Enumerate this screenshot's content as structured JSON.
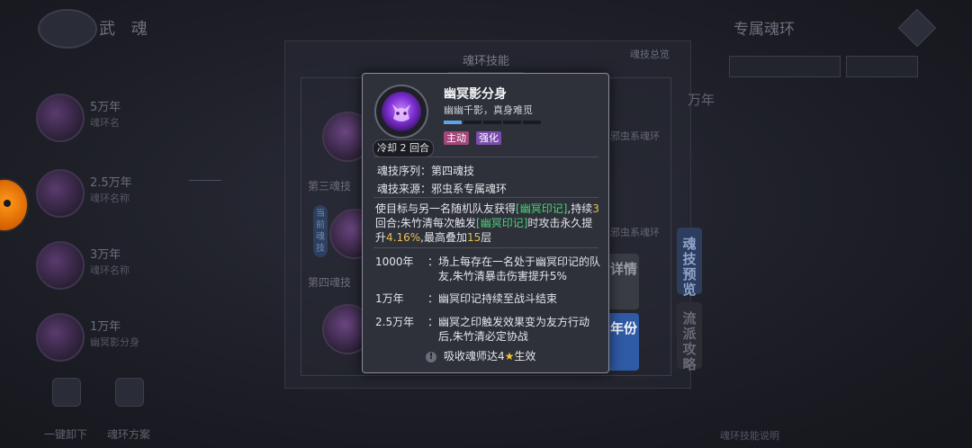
{
  "background": {
    "top_title": "武 魂",
    "top_right_title": "专属魂环",
    "dropdowns": [
      "",
      ""
    ],
    "left_rings": [
      {
        "year": "5万年",
        "name": "魂环名"
      },
      {
        "year": "2.5万年",
        "name": "魂环名称"
      },
      {
        "year": "3万年",
        "name": "魂环名称"
      },
      {
        "year": "1万年",
        "name": "幽冥影分身"
      }
    ],
    "center_title": "魂环技能",
    "overview_label": "魂技总览",
    "tier_third": "第三魂技",
    "tier_fourth": "第四魂技",
    "current_tag": "当前魂技",
    "evil_ring_1": "邪虫系魂环",
    "evil_ring_2": "邪虫系魂环",
    "year_peek": "万年",
    "tab_preview": "魂技预览",
    "tab_strategy": "流派攻略",
    "bottom_buttons": [
      "一键卸下",
      "魂环方案"
    ],
    "bottom_hint": "魂环技能说明"
  },
  "side_buttons": {
    "detail": "详情",
    "year": "年份"
  },
  "popup": {
    "cooldown": "冷却 2 回合",
    "name": "幽冥影分身",
    "subtitle": "幽幽千影，真身难觅",
    "level_segments": {
      "filled": 1,
      "total": 5
    },
    "tags": {
      "active": "主动",
      "enhance": "强化"
    },
    "sequence_label": "魂技序列：",
    "sequence_value": "第四魂技",
    "source_label": "魂技来源：",
    "source_value": "邪虫系专属魂环",
    "desc": {
      "p1": "使目标与另一名随机队友获得",
      "mark1": "[幽冥印记]",
      "p2": ",持续",
      "n1": "3",
      "p3": "回合;朱竹清每次触发",
      "mark2": "[幽冥印记]",
      "p4": "时攻击永久提升",
      "pct": "4.16%",
      "p5": ",最高叠加",
      "n2": "15",
      "p6": "层"
    },
    "year_effects": [
      {
        "year": "1000年",
        "colon": "：",
        "text": "场上每存在一名处于幽冥印记的队友,朱竹清暴击伤害提升5%"
      },
      {
        "year": "1万年",
        "colon": "：",
        "text": "幽冥印记持续至战斗结束"
      },
      {
        "year": "2.5万年",
        "colon": "：",
        "text": "幽冥之印触发效果变为友方行动后,朱竹清必定协战"
      }
    ],
    "absorb_warn": "!",
    "absorb_pre": "吸收魂师达4",
    "absorb_star": "★",
    "absorb_post": "生效"
  }
}
